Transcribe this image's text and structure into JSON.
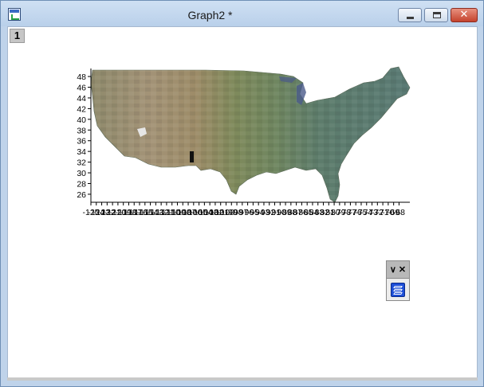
{
  "window": {
    "title": "Graph2 *",
    "icon": "graph-window-icon",
    "controls": {
      "minimize": "minimize-icon",
      "maximize": "maximize-icon",
      "close_glyph": "✕"
    }
  },
  "layer_tab": {
    "label": "1"
  },
  "mini_toolbar": {
    "header_label": "∨ ✕",
    "button_icon": "layer-stack-icon"
  },
  "chart_data": {
    "type": "image-map",
    "title": "",
    "xlabel": "",
    "ylabel": "",
    "y_ticks": [
      26,
      28,
      30,
      32,
      34,
      36,
      38,
      40,
      42,
      44,
      46,
      48
    ],
    "ylim": [
      24.5,
      49.5
    ],
    "xlim": [
      -125,
      -66
    ],
    "x_ticks": [
      -125,
      -124,
      -123,
      -122,
      -121,
      -120,
      -119,
      -118,
      -117,
      -116,
      -115,
      -114,
      -113,
      -112,
      -111,
      -110,
      -109,
      -108,
      -107,
      -106,
      -105,
      -104,
      -103,
      -102,
      -101,
      -100,
      -99,
      -98,
      -97,
      -96,
      -95,
      -94,
      -93,
      -92,
      -91,
      -90,
      -89,
      -88,
      -87,
      -86,
      -85,
      -84,
      -83,
      -82,
      -81,
      -80,
      -79,
      -78,
      -77,
      -76,
      -75,
      -74,
      -73,
      -72,
      -71,
      -70,
      -69,
      -68
    ],
    "image_description_colors": {
      "west": "#9c8a6a",
      "plains": "#7e8c5e",
      "east": "#5f7e72",
      "lake": "#4a5a8a"
    }
  }
}
